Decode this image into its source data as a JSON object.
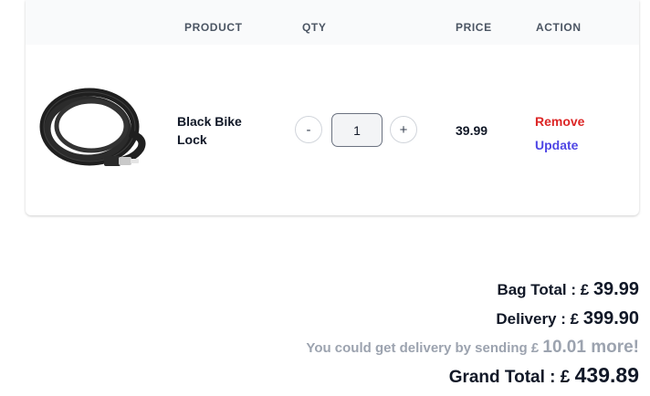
{
  "table": {
    "headers": {
      "product": "PRODUCT",
      "qty": "QTY",
      "price": "PRICE",
      "action": "ACTION"
    },
    "items": [
      {
        "name": "Black Bike Lock",
        "image_icon": "bike-lock-cable-image",
        "quantity": "1",
        "decrement_label": "-",
        "increment_label": "+",
        "price": "39.99",
        "remove_label": "Remove",
        "update_label": "Update"
      }
    ]
  },
  "summary": {
    "bag_total_label": "Bag Total : £",
    "bag_total_value": "39.99",
    "delivery_label": "Delivery : £",
    "delivery_value": "399.90",
    "hint_label": "You could get delivery by sending £",
    "hint_value": "10.01 more!",
    "grand_total_label": "Grand Total : £",
    "grand_total_value": "439.89"
  },
  "colors": {
    "remove": "#dc2626",
    "update": "#4f46e5",
    "header_bg": "#f9fafb",
    "hint": "#9ca3af"
  }
}
